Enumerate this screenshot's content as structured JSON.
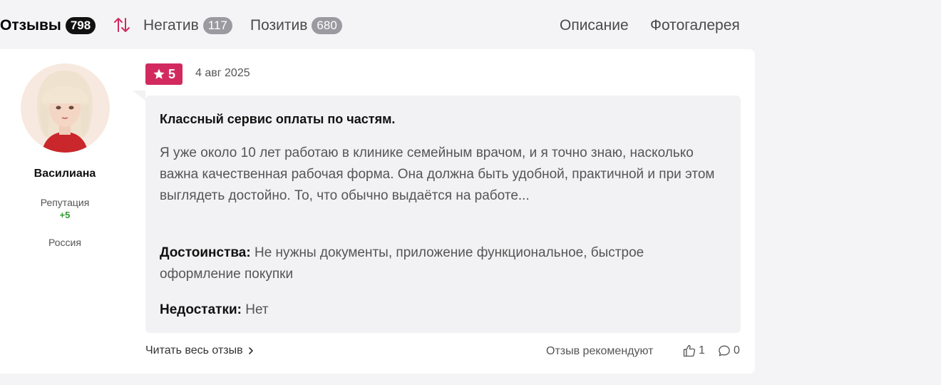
{
  "tabs": {
    "reviews": {
      "label": "Отзывы",
      "count": "798"
    },
    "sort_icon": "sort-arrows-icon",
    "negative": {
      "label": "Негатив",
      "count": "117"
    },
    "positive": {
      "label": "Позитив",
      "count": "680"
    },
    "description": {
      "label": "Описание"
    },
    "gallery": {
      "label": "Фотогалерея"
    }
  },
  "review": {
    "author": {
      "name": "Василиана",
      "reputation_label": "Репутация",
      "reputation_value": "+5",
      "country": "Россия"
    },
    "rating": "5",
    "date": "4 авг 2025",
    "title": "Классный сервис оплаты по частям.",
    "body": "Я уже около 10 лет работаю в клинике семейным врачом, и я точно знаю, насколько важна качественная рабочая форма. Она должна быть удобной, практичной и при этом выглядеть достойно. То, что обычно выдаётся на работе...",
    "pros_label": "Достоинства:",
    "pros": "Не нужны документы, приложение функциональное, быстрое оформление покупки",
    "cons_label": "Недостатки:",
    "cons": "Нет",
    "read_more": "Читать весь отзыв",
    "recommend_label": "Отзыв рекомендуют",
    "likes": "1",
    "comments": "0"
  },
  "colors": {
    "rating_badge": "#d22a5f",
    "sort_icon": "#d22a5f",
    "reputation_positive": "#2f9a2f"
  }
}
